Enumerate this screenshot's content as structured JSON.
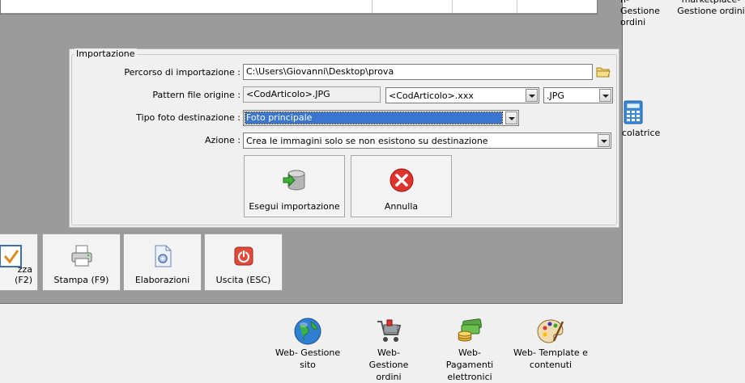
{
  "desktop": {
    "top_right_1": "n- Gestione ordini",
    "top_right_2": "marketplace- Gestione ordini",
    "calc_label": "colatrice"
  },
  "import": {
    "group_title": "Importazione",
    "path_label": "Percorso di importazione :",
    "path_value": "C:\\Users\\Giovanni\\Desktop\\prova",
    "pattern_label": "Pattern file origine :",
    "pattern_value": "<CodArticolo>.JPG",
    "pattern_combo": "<CodArticolo>.xxx",
    "ext_combo": ".JPG",
    "photo_type_label": "Tipo foto destinazione :",
    "photo_type_value": "Foto principale",
    "action_label": "Azione :",
    "action_value": "Crea le immagini solo se non esistono su destinazione",
    "run_label": "Esegui importazione",
    "cancel_label": "Annulla"
  },
  "toolbar": {
    "btn1": "zza (F2)",
    "btn2": "Stampa (F9)",
    "btn3": "Elaborazioni",
    "btn4": "Uscita (ESC)"
  },
  "web": {
    "sito": "Web- Gestione sito",
    "ordini": "Web- Gestione ordini",
    "pagamenti": "Web- Pagamenti elettronici",
    "template": "Web- Template e contenuti"
  }
}
